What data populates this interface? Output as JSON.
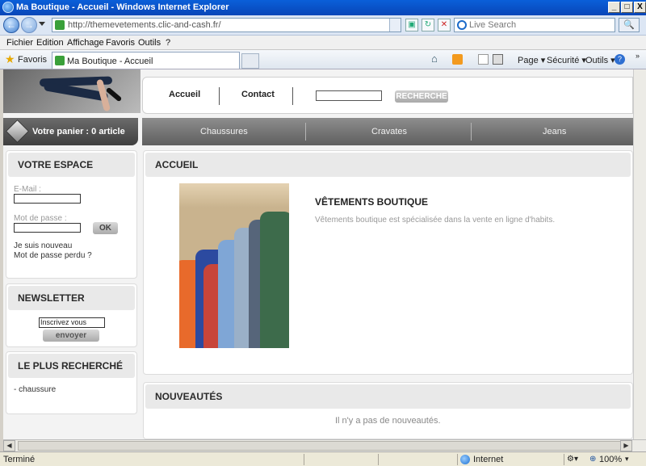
{
  "window": {
    "title": "Ma Boutique - Accueil - Windows Internet Explorer",
    "minimize": "_",
    "restore": "□",
    "close": "X"
  },
  "address_bar": {
    "url": "http://themevetements.clic-and-cash.fr/",
    "search_placeholder": "Live Search"
  },
  "menu": [
    "Fichier",
    "Edition",
    "Affichage",
    "Favoris",
    "Outils",
    "?"
  ],
  "favorites_bar": {
    "favorites_label": "Favoris",
    "tab_label": "Ma Boutique - Accueil",
    "commands": [
      "Page ▾",
      "Sécurité ▾",
      "Outils ▾"
    ]
  },
  "site": {
    "nav": [
      "Accueil",
      "Contact"
    ],
    "search_button": "RECHERCHE",
    "cart": "Votre panier : 0 article",
    "categories": [
      "Chaussures",
      "Cravates",
      "Jeans"
    ],
    "account": {
      "title": "VOTRE ESPACE",
      "email_label": "E-Mail :",
      "password_label": "Mot de passe :",
      "ok_label": "OK",
      "new_user": "Je suis nouveau",
      "lost_password": "Mot de passe perdu ?"
    },
    "newsletter": {
      "title": "NEWSLETTER",
      "input_value": "Inscrivez vous",
      "button": "envoyer"
    },
    "popular": {
      "title": "LE PLUS RECHERCHÉ",
      "items": [
        "- chaussure"
      ]
    },
    "home": {
      "title": "ACCUEIL",
      "product_title": "VÊTEMENTS BOUTIQUE",
      "product_desc": "Vêtements boutique est spécialisée dans la vente en ligne d'habits."
    },
    "news": {
      "title": "NOUVEAUTÉS",
      "empty": "Il n'y a pas de nouveautés."
    }
  },
  "status_bar": {
    "status": "Terminé",
    "zone": "Internet",
    "zoom": "100%"
  }
}
